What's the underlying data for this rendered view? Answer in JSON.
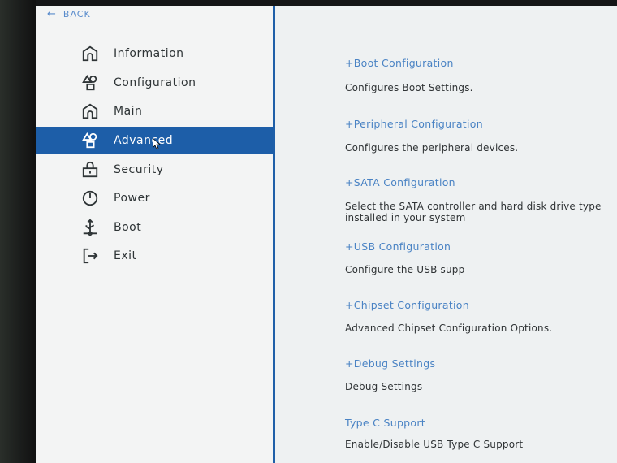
{
  "back_label": "BACK",
  "sidebar": {
    "items": [
      {
        "label": "Information",
        "icon": "home-icon",
        "active": false
      },
      {
        "label": "Configuration",
        "icon": "shapes-icon",
        "active": false
      },
      {
        "label": "Main",
        "icon": "home-icon",
        "active": false
      },
      {
        "label": "Advanced",
        "icon": "shapes-icon",
        "active": true
      },
      {
        "label": "Security",
        "icon": "lock-icon",
        "active": false
      },
      {
        "label": "Power",
        "icon": "power-icon",
        "active": false
      },
      {
        "label": "Boot",
        "icon": "usb-icon",
        "active": false
      },
      {
        "label": "Exit",
        "icon": "exit-icon",
        "active": false
      }
    ]
  },
  "main": {
    "entries": [
      {
        "title": "+Boot Configuration",
        "description": "Configures Boot Settings."
      },
      {
        "title": "+Peripheral Configuration",
        "description": "Configures the peripheral devices."
      },
      {
        "title": "+SATA Configuration",
        "description": "Select the SATA controller and hard disk drive type installed in your system"
      },
      {
        "title": "+USB Configuration",
        "description": "Configure the USB supp"
      },
      {
        "title": "+Chipset Configuration",
        "description": "Advanced Chipset Configuration Options."
      },
      {
        "title": "+Debug Settings",
        "description": "Debug Settings"
      },
      {
        "title": "Type C Support",
        "description": "Enable/Disable USB Type C Support"
      }
    ]
  },
  "colors": {
    "accent": "#1d5ea8",
    "link": "#4a83c4",
    "text": "#2e3436",
    "background": "#f1f3f3"
  }
}
